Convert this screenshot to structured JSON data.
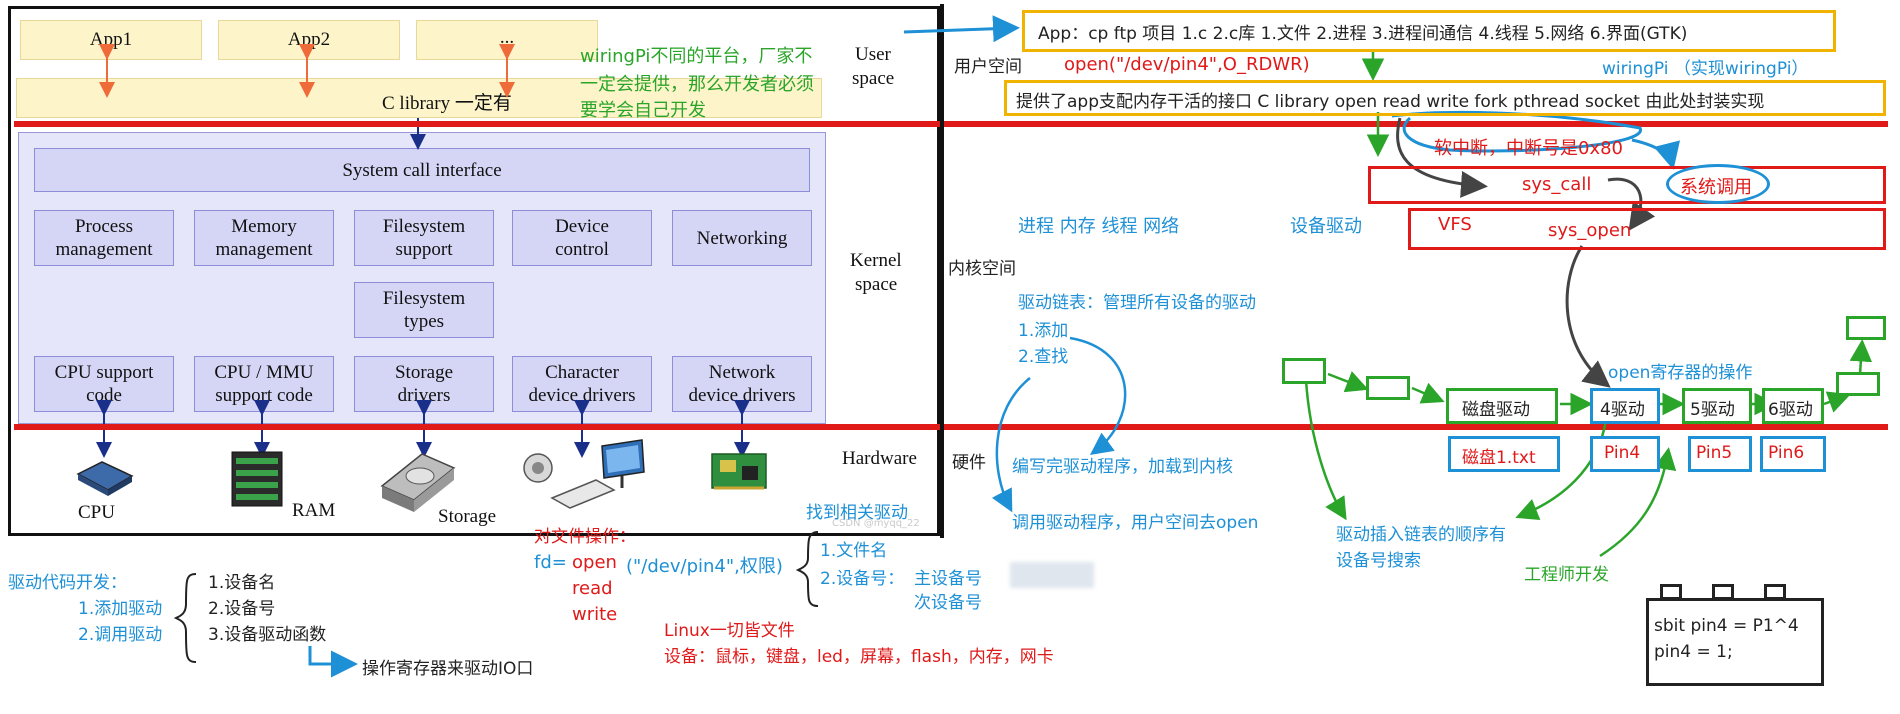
{
  "left_diagram": {
    "user_space": {
      "apps": [
        "App1",
        "App2",
        "..."
      ],
      "c_library": "C library 一定有",
      "label_line1": "User",
      "label_line2": "space"
    },
    "kernel_space": {
      "label_line1": "Kernel",
      "label_line2": "space",
      "syscall": "System call interface",
      "row1": [
        {
          "line1": "Process",
          "line2": "management"
        },
        {
          "line1": "Memory",
          "line2": "management"
        },
        {
          "line1": "Filesystem",
          "line2": "support"
        },
        {
          "line1": "Device",
          "line2": "control"
        },
        {
          "line1": "Networking",
          "line2": ""
        }
      ],
      "fs_types": {
        "line1": "Filesystem",
        "line2": "types"
      },
      "row3": [
        {
          "line1": "CPU support",
          "line2": "code"
        },
        {
          "line1": "CPU / MMU",
          "line2": "support code"
        },
        {
          "line1": "Storage",
          "line2": "drivers"
        },
        {
          "line1": "Character",
          "line2": "device drivers"
        },
        {
          "line1": "Network",
          "line2": "device drivers"
        }
      ]
    },
    "hardware": {
      "label": "Hardware",
      "items": [
        "CPU",
        "RAM",
        "Storage"
      ]
    },
    "wiringpi_note": [
      "wiringPi不同的平台，厂家不",
      "一定会提供，那么开发者必须",
      "要学会自己开发"
    ],
    "watermark": "CSDN @myqq_22"
  },
  "right_diagram": {
    "app_line": "App：cp  ftp  项目     1.c  2.c库      1.文件 2.进程 3.进程间通信 4.线程 5.网络 6.界面(GTK)",
    "user_space_label": "用户空间",
    "open_call": "open(\"/dev/pin4\",O_RDWR)",
    "wiringpi": "wiringPi   （实现wiringPi）",
    "clib_line": "提供了app支配内存干活的接口 C library   open read write fork pthread socket 由此处封装实现",
    "soft_irq": "软中断，中断号是0x80",
    "sys_call": "sys_call",
    "syscall_circle": "系统调用",
    "kernel_items": "进程   内存   线程   网络",
    "device_driver": "设备驱动",
    "vfs": "VFS",
    "sys_open": "sys_open",
    "kernel_space_label": "内核空间",
    "driver_list_title": "驱动链表：管理所有设备的驱动",
    "driver_list_items": [
      "1.添加",
      "2.查找"
    ],
    "open_register": "open寄存器的操作",
    "chain": [
      "磁盘驱动",
      "4驱动",
      "5驱动",
      "6驱动"
    ],
    "hardware_label": "硬件",
    "devices": [
      "磁盘1.txt",
      "Pin4",
      "Pin5",
      "Pin6"
    ],
    "write_driver": "编写完驱动程序，加载到内核",
    "call_driver": "调用驱动程序，用户空间去open",
    "insert_order": [
      "驱动插入链表的顺序有",
      "设备号搜索"
    ],
    "engineer": "工程师开发",
    "code": [
      "sbit pin4 = P1^4",
      "pin4 = 1;"
    ]
  },
  "bottom_notes": {
    "driver_dev_title": "驱动代码开发：",
    "driver_dev_items": [
      "1.添加驱动",
      "2.调用驱动"
    ],
    "device_info": [
      "1.设备名",
      "2.设备号",
      "3.设备驱动函数"
    ],
    "register_op": "操作寄存器来驱动IO口",
    "file_ops_title": "对文件操作：",
    "fd_label": "fd=",
    "file_ops": [
      "open",
      "read",
      "write"
    ],
    "open_args": "(\"/dev/pin4\",权限)",
    "find_driver": "找到相关驱动",
    "file_name": "1.文件名",
    "device_no": "2.设备号：",
    "major": "主设备号",
    "minor": "次设备号",
    "everything_file": "Linux一切皆文件",
    "devices_list": "设备：鼠标，键盘，led，屏幕，flash，内存，网卡"
  },
  "colors": {
    "red": "#e01919",
    "blue": "#1e90d6",
    "green": "#2aa52a",
    "yellow": "#f0b400",
    "kernel_fill": "#e6e6fa",
    "box_fill": "#d5d5f5",
    "app_fill": "#fdf5c9"
  }
}
